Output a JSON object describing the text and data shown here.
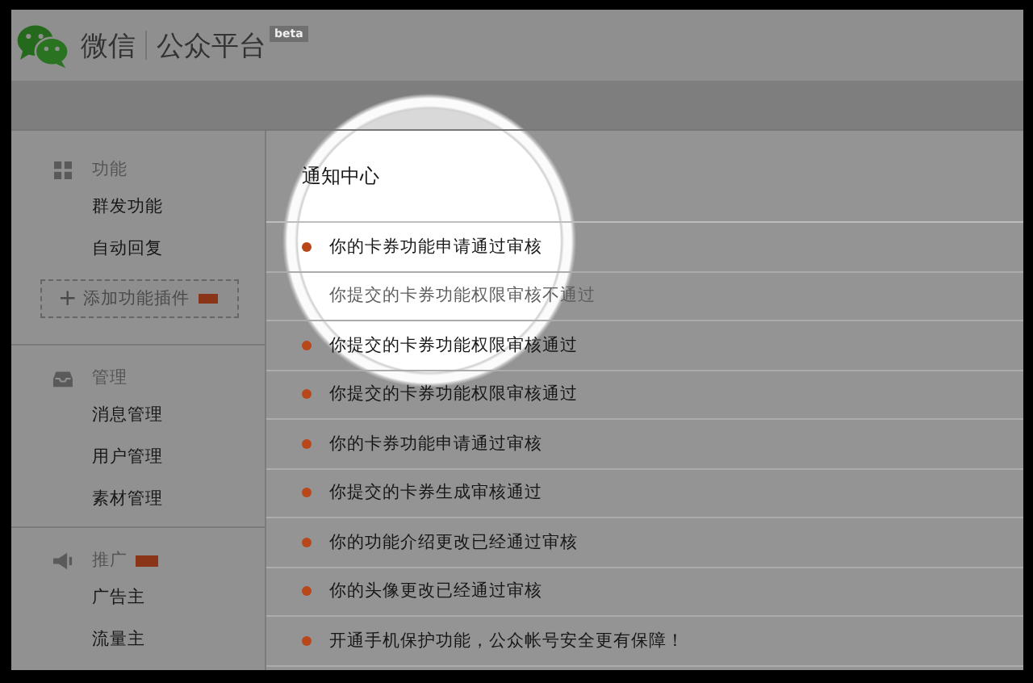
{
  "header": {
    "brand": "微信",
    "product": "公众平台",
    "badge": "beta"
  },
  "sidebar": {
    "groups": [
      {
        "title": "功能",
        "new": false,
        "items": [
          "群发功能",
          "自动回复"
        ],
        "add_button": {
          "label": "添加功能插件",
          "plus": "+",
          "new": true
        }
      },
      {
        "title": "管理",
        "new": false,
        "items": [
          "消息管理",
          "用户管理",
          "素材管理"
        ]
      },
      {
        "title": "推广",
        "new": true,
        "items": [
          "广告主",
          "流量主"
        ]
      }
    ]
  },
  "notifications": {
    "title": "通知中心",
    "items": [
      {
        "text": "你的卡券功能申请通过审核",
        "unread": true
      },
      {
        "text": "你提交的卡券功能权限审核不通过",
        "unread": false
      },
      {
        "text": "你提交的卡券功能权限审核通过",
        "unread": true
      },
      {
        "text": "你提交的卡券功能权限审核通过",
        "unread": true
      },
      {
        "text": "你的卡券功能申请通过审核",
        "unread": true
      },
      {
        "text": "你提交的卡券生成审核通过",
        "unread": true
      },
      {
        "text": "你的功能介绍更改已经通过审核",
        "unread": true
      },
      {
        "text": "你的头像更改已经通过审核",
        "unread": true
      },
      {
        "text": "开通手机保护功能，公众帐号安全更有保障！",
        "unread": true
      }
    ]
  }
}
